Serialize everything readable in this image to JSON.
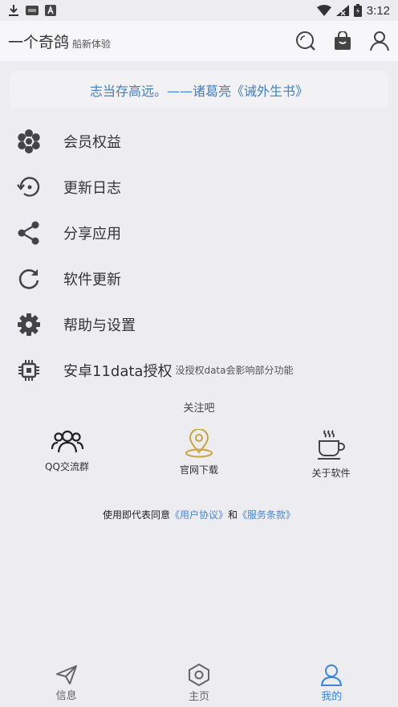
{
  "status_bar": {
    "time": "3:12"
  },
  "header": {
    "title": "一个奇鸽",
    "subtitle": "船新体验"
  },
  "quote": "志当存高远。——诸葛亮《诫外生书》",
  "menu": [
    {
      "label": "会员权益",
      "icon": "flower-icon"
    },
    {
      "label": "更新日志",
      "icon": "history-icon"
    },
    {
      "label": "分享应用",
      "icon": "share-icon"
    },
    {
      "label": "软件更新",
      "icon": "refresh-icon"
    },
    {
      "label": "帮助与设置",
      "icon": "gear-icon"
    },
    {
      "label": "安卓11data授权",
      "note": "没授权data会影响部分功能",
      "icon": "chip-icon"
    }
  ],
  "follow": {
    "title": "关注吧",
    "items": [
      {
        "label": "QQ交流群",
        "icon": "group-icon"
      },
      {
        "label": "官网下载",
        "icon": "location-pin-icon"
      },
      {
        "label": "关于软件",
        "icon": "coffee-cup-icon"
      }
    ]
  },
  "agreement": {
    "prefix": "使用即代表同意",
    "user_agreement": "《用户协议》",
    "conjunction": "和",
    "service_terms": "《服务条款》"
  },
  "tabs": [
    {
      "label": "信息",
      "icon": "send-icon"
    },
    {
      "label": "主页",
      "icon": "hexagon-icon"
    },
    {
      "label": "我的",
      "icon": "user-icon",
      "active": true
    }
  ],
  "colors": {
    "accent": "#3A86E0",
    "quote": "#3D7FC9",
    "pin": "#C9A441",
    "background": "#ECECF1"
  }
}
